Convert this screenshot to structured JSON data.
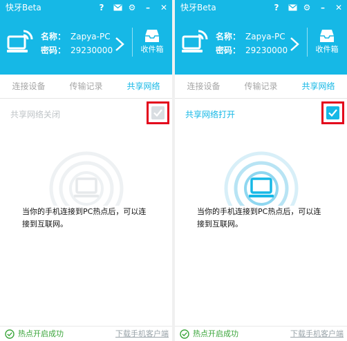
{
  "app": {
    "title": "快牙Beta"
  },
  "window_controls": {
    "help": "?",
    "mail_icon": "mail-icon",
    "settings_icon": "gear-icon",
    "minimize": "–",
    "close": "✕"
  },
  "device": {
    "name_label": "名称：",
    "name_value": "Zapya-PC",
    "password_label": "密码：",
    "password_value": "29230000"
  },
  "inbox": {
    "label": "收件箱",
    "icon": "inbox-tray-icon"
  },
  "tabs": [
    "连接设备",
    "传输记录",
    "共享网络"
  ],
  "panels": [
    {
      "state": "off",
      "status_text": "共享网络关闭",
      "checked": false
    },
    {
      "state": "on",
      "status_text": "共享网络打开",
      "checked": true
    }
  ],
  "description": "当你的手机连接到PC热点后，可以连接到互联网。",
  "footer": {
    "status": "热点开启成功",
    "link": "下载手机客户端"
  },
  "colors": {
    "accent": "#16b8e6",
    "highlight_frame": "#e3001b",
    "success": "#3aa53a",
    "muted_icon": "#e9ecee"
  }
}
